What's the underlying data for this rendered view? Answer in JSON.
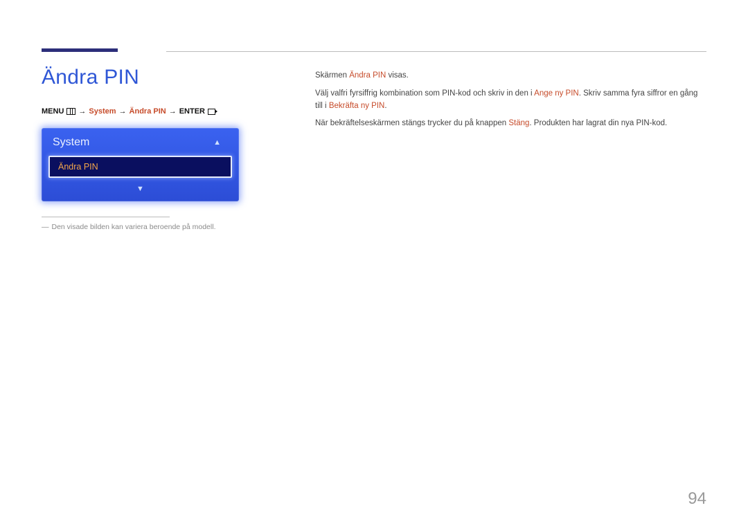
{
  "page_number": "94",
  "title": "Ändra PIN",
  "breadcrumb": {
    "menu": "MENU",
    "system": "System",
    "andra_pin": "Ändra PIN",
    "enter": "ENTER"
  },
  "osd": {
    "header": "System",
    "selected_item": "Ändra PIN"
  },
  "footnote": "Den visade bilden kan variera beroende på modell.",
  "body": {
    "p1_a": "Skärmen ",
    "p1_hl": "Ändra PIN",
    "p1_b": " visas.",
    "p2_a": "Välj valfri fyrsiffrig kombination som PIN-kod och skriv in den i ",
    "p2_hl1": "Ange ny PIN",
    "p2_b": ". Skriv samma fyra siffror en gång till i ",
    "p2_hl2": "Bekräfta ny PIN",
    "p2_c": ".",
    "p3_a": "När bekräftelseskärmen stängs trycker du på knappen ",
    "p3_hl": "Stäng",
    "p3_b": ". Produkten har lagrat din nya PIN-kod."
  }
}
